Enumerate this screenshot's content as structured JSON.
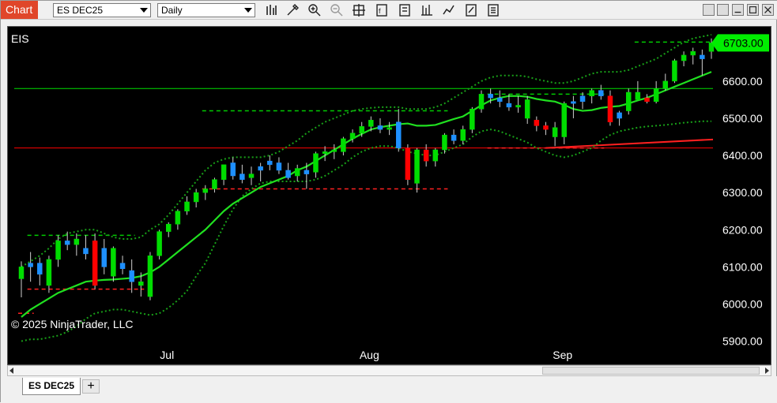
{
  "window": {
    "tab_label": "Chart"
  },
  "toolbar": {
    "instrument": "ES DEC25",
    "interval": "Daily",
    "icons": [
      "bars-type-icon",
      "drawing-tools-icon",
      "zoom-in-icon",
      "zoom-out-icon",
      "crosshair-icon",
      "indicators-icon",
      "strategies-icon",
      "chart-trader-icon",
      "templates-icon",
      "properties-icon",
      "data-box-icon",
      "minimize-icon",
      "maximize-icon",
      "close-icon"
    ]
  },
  "chart": {
    "symbol_label": "EIS",
    "copyright": "© 2025 NinjaTrader, LLC",
    "last_price_label": "6703.00",
    "colors": {
      "up": "#00dd00",
      "down": "#ff0000",
      "flat_up": "#1e90ff",
      "ma": "#20e020",
      "band": "#18a018",
      "background": "#000000",
      "last_price_bg": "#00ee00"
    }
  },
  "chart_data": {
    "type": "candlestick",
    "ylim": [
      5880,
      6725
    ],
    "y_ticks": [
      "6600.00",
      "6500.00",
      "6400.00",
      "6300.00",
      "6200.00",
      "6100.00",
      "6000.00",
      "5900.00"
    ],
    "y_tick_values": [
      6600,
      6500,
      6400,
      6300,
      6200,
      6100,
      6000,
      5900
    ],
    "x_ticks": [
      {
        "label": "Jul",
        "index": 16
      },
      {
        "label": "Aug",
        "index": 38
      },
      {
        "label": "Sep",
        "index": 59
      }
    ],
    "bar_count": 76,
    "candles": [
      {
        "o": 6068,
        "h": 6115,
        "l": 6018,
        "c": 6100,
        "k": "up"
      },
      {
        "o": 6100,
        "h": 6140,
        "l": 6060,
        "c": 6110,
        "k": "flat"
      },
      {
        "o": 6110,
        "h": 6125,
        "l": 6050,
        "c": 6080,
        "k": "flat"
      },
      {
        "o": 6050,
        "h": 6130,
        "l": 6030,
        "c": 6120,
        "k": "up"
      },
      {
        "o": 6120,
        "h": 6185,
        "l": 6100,
        "c": 6170,
        "k": "up"
      },
      {
        "o": 6170,
        "h": 6195,
        "l": 6145,
        "c": 6160,
        "k": "flat"
      },
      {
        "o": 6160,
        "h": 6190,
        "l": 6130,
        "c": 6175,
        "k": "up"
      },
      {
        "o": 6150,
        "h": 6185,
        "l": 6120,
        "c": 6135,
        "k": "flat"
      },
      {
        "o": 6170,
        "h": 6190,
        "l": 6040,
        "c": 6050,
        "k": "down"
      },
      {
        "o": 6150,
        "h": 6175,
        "l": 6080,
        "c": 6100,
        "k": "flat"
      },
      {
        "o": 6075,
        "h": 6155,
        "l": 6060,
        "c": 6150,
        "k": "up"
      },
      {
        "o": 6110,
        "h": 6130,
        "l": 6080,
        "c": 6095,
        "k": "flat"
      },
      {
        "o": 6090,
        "h": 6120,
        "l": 6030,
        "c": 6060,
        "k": "flat"
      },
      {
        "o": 6060,
        "h": 6085,
        "l": 6020,
        "c": 6050,
        "k": "up"
      },
      {
        "o": 6020,
        "h": 6140,
        "l": 6010,
        "c": 6130,
        "k": "up"
      },
      {
        "o": 6130,
        "h": 6200,
        "l": 6120,
        "c": 6195,
        "k": "up"
      },
      {
        "o": 6195,
        "h": 6220,
        "l": 6180,
        "c": 6215,
        "k": "up"
      },
      {
        "o": 6215,
        "h": 6255,
        "l": 6200,
        "c": 6250,
        "k": "up"
      },
      {
        "o": 6250,
        "h": 6290,
        "l": 6240,
        "c": 6275,
        "k": "up"
      },
      {
        "o": 6275,
        "h": 6310,
        "l": 6260,
        "c": 6300,
        "k": "up"
      },
      {
        "o": 6300,
        "h": 6320,
        "l": 6280,
        "c": 6310,
        "k": "up"
      },
      {
        "o": 6310,
        "h": 6340,
        "l": 6300,
        "c": 6335,
        "k": "up"
      },
      {
        "o": 6335,
        "h": 6375,
        "l": 6320,
        "c": 6375,
        "k": "up"
      },
      {
        "o": 6380,
        "h": 6395,
        "l": 6335,
        "c": 6345,
        "k": "flat"
      },
      {
        "o": 6350,
        "h": 6375,
        "l": 6325,
        "c": 6335,
        "k": "flat"
      },
      {
        "o": 6340,
        "h": 6370,
        "l": 6320,
        "c": 6350,
        "k": "up"
      },
      {
        "o": 6360,
        "h": 6380,
        "l": 6330,
        "c": 6370,
        "k": "flat"
      },
      {
        "o": 6385,
        "h": 6400,
        "l": 6360,
        "c": 6375,
        "k": "flat"
      },
      {
        "o": 6380,
        "h": 6395,
        "l": 6350,
        "c": 6360,
        "k": "flat"
      },
      {
        "o": 6360,
        "h": 6380,
        "l": 6335,
        "c": 6340,
        "k": "flat"
      },
      {
        "o": 6345,
        "h": 6375,
        "l": 6330,
        "c": 6365,
        "k": "up"
      },
      {
        "o": 6360,
        "h": 6380,
        "l": 6310,
        "c": 6350,
        "k": "flat"
      },
      {
        "o": 6355,
        "h": 6410,
        "l": 6340,
        "c": 6405,
        "k": "up"
      },
      {
        "o": 6405,
        "h": 6425,
        "l": 6385,
        "c": 6410,
        "k": "up"
      },
      {
        "o": 6410,
        "h": 6430,
        "l": 6390,
        "c": 6415,
        "k": "up"
      },
      {
        "o": 6410,
        "h": 6450,
        "l": 6400,
        "c": 6445,
        "k": "up"
      },
      {
        "o": 6445,
        "h": 6470,
        "l": 6435,
        "c": 6460,
        "k": "up"
      },
      {
        "o": 6460,
        "h": 6490,
        "l": 6450,
        "c": 6478,
        "k": "up"
      },
      {
        "o": 6478,
        "h": 6505,
        "l": 6465,
        "c": 6495,
        "k": "up"
      },
      {
        "o": 6480,
        "h": 6500,
        "l": 6460,
        "c": 6470,
        "k": "flat"
      },
      {
        "o": 6470,
        "h": 6490,
        "l": 6455,
        "c": 6475,
        "k": "up"
      },
      {
        "o": 6490,
        "h": 6525,
        "l": 6410,
        "c": 6420,
        "k": "flat"
      },
      {
        "o": 6420,
        "h": 6430,
        "l": 6320,
        "c": 6335,
        "k": "down"
      },
      {
        "o": 6325,
        "h": 6420,
        "l": 6300,
        "c": 6415,
        "k": "up"
      },
      {
        "o": 6415,
        "h": 6430,
        "l": 6370,
        "c": 6385,
        "k": "down"
      },
      {
        "o": 6385,
        "h": 6420,
        "l": 6370,
        "c": 6415,
        "k": "up"
      },
      {
        "o": 6415,
        "h": 6460,
        "l": 6405,
        "c": 6455,
        "k": "up"
      },
      {
        "o": 6455,
        "h": 6470,
        "l": 6430,
        "c": 6440,
        "k": "flat"
      },
      {
        "o": 6440,
        "h": 6480,
        "l": 6430,
        "c": 6470,
        "k": "up"
      },
      {
        "o": 6470,
        "h": 6530,
        "l": 6460,
        "c": 6525,
        "k": "up"
      },
      {
        "o": 6525,
        "h": 6575,
        "l": 6515,
        "c": 6565,
        "k": "up"
      },
      {
        "o": 6565,
        "h": 6580,
        "l": 6540,
        "c": 6555,
        "k": "flat"
      },
      {
        "o": 6555,
        "h": 6575,
        "l": 6530,
        "c": 6545,
        "k": "flat"
      },
      {
        "o": 6540,
        "h": 6565,
        "l": 6520,
        "c": 6530,
        "k": "flat"
      },
      {
        "o": 6530,
        "h": 6560,
        "l": 6515,
        "c": 6535,
        "k": "up"
      },
      {
        "o": 6500,
        "h": 6560,
        "l": 6485,
        "c": 6550,
        "k": "up"
      },
      {
        "o": 6495,
        "h": 6505,
        "l": 6465,
        "c": 6480,
        "k": "down"
      },
      {
        "o": 6480,
        "h": 6490,
        "l": 6455,
        "c": 6470,
        "k": "down"
      },
      {
        "o": 6475,
        "h": 6490,
        "l": 6425,
        "c": 6450,
        "k": "up"
      },
      {
        "o": 6450,
        "h": 6545,
        "l": 6430,
        "c": 6540,
        "k": "up"
      },
      {
        "o": 6540,
        "h": 6560,
        "l": 6500,
        "c": 6545,
        "k": "flat"
      },
      {
        "o": 6545,
        "h": 6570,
        "l": 6525,
        "c": 6560,
        "k": "flat"
      },
      {
        "o": 6560,
        "h": 6580,
        "l": 6540,
        "c": 6575,
        "k": "up"
      },
      {
        "o": 6575,
        "h": 6590,
        "l": 6550,
        "c": 6560,
        "k": "flat"
      },
      {
        "o": 6560,
        "h": 6575,
        "l": 6480,
        "c": 6490,
        "k": "down"
      },
      {
        "o": 6500,
        "h": 6520,
        "l": 6480,
        "c": 6515,
        "k": "flat"
      },
      {
        "o": 6520,
        "h": 6580,
        "l": 6510,
        "c": 6570,
        "k": "up"
      },
      {
        "o": 6570,
        "h": 6600,
        "l": 6550,
        "c": 6550,
        "k": "up"
      },
      {
        "o": 6555,
        "h": 6565,
        "l": 6540,
        "c": 6545,
        "k": "down"
      },
      {
        "o": 6545,
        "h": 6600,
        "l": 6540,
        "c": 6580,
        "k": "up"
      },
      {
        "o": 6580,
        "h": 6620,
        "l": 6575,
        "c": 6600,
        "k": "up"
      },
      {
        "o": 6600,
        "h": 6660,
        "l": 6595,
        "c": 6655,
        "k": "up"
      },
      {
        "o": 6655,
        "h": 6680,
        "l": 6640,
        "c": 6670,
        "k": "up"
      },
      {
        "o": 6670,
        "h": 6690,
        "l": 6645,
        "c": 6680,
        "k": "up"
      },
      {
        "o": 6670,
        "h": 6685,
        "l": 6615,
        "c": 6660,
        "k": "flat"
      },
      {
        "o": 6680,
        "h": 6715,
        "l": 6660,
        "c": 6703,
        "k": "up"
      }
    ],
    "moving_average": [
      5965,
      5985,
      6000,
      6015,
      6030,
      6040,
      6050,
      6060,
      6063,
      6065,
      6066,
      6068,
      6070,
      6075,
      6085,
      6100,
      6120,
      6140,
      6160,
      6180,
      6200,
      6225,
      6250,
      6270,
      6285,
      6300,
      6315,
      6325,
      6335,
      6345,
      6360,
      6370,
      6385,
      6400,
      6415,
      6430,
      6445,
      6458,
      6470,
      6476,
      6480,
      6484,
      6486,
      6480,
      6480,
      6482,
      6490,
      6498,
      6505,
      6520,
      6535,
      6548,
      6555,
      6560,
      6560,
      6558,
      6552,
      6548,
      6545,
      6536,
      6525,
      6520,
      6522,
      6528,
      6531,
      6533,
      6540,
      6548,
      6555,
      6565,
      6575,
      6585,
      6595,
      6605,
      6615,
      6625
    ],
    "band_upper": [
      6100,
      6115,
      6130,
      6150,
      6175,
      6190,
      6195,
      6200,
      6200,
      6190,
      6180,
      6175,
      6175,
      6180,
      6200,
      6215,
      6240,
      6270,
      6300,
      6330,
      6360,
      6380,
      6390,
      6395,
      6395,
      6395,
      6395,
      6400,
      6410,
      6425,
      6440,
      6460,
      6475,
      6490,
      6500,
      6510,
      6520,
      6525,
      6528,
      6530,
      6530,
      6530,
      6525,
      6525,
      6525,
      6530,
      6540,
      6555,
      6570,
      6585,
      6600,
      6610,
      6615,
      6615,
      6615,
      6612,
      6605,
      6600,
      6595,
      6595,
      6600,
      6610,
      6620,
      6625,
      6625,
      6625,
      6630,
      6640,
      6650,
      6660,
      6675,
      6690,
      6705,
      6715,
      6720,
      6725
    ],
    "band_lower": [
      5900,
      5905,
      5905,
      5910,
      5915,
      5925,
      5940,
      5960,
      5975,
      5980,
      5985,
      5985,
      5980,
      5975,
      5970,
      5975,
      5990,
      6010,
      6035,
      6075,
      6110,
      6160,
      6210,
      6255,
      6290,
      6310,
      6325,
      6330,
      6330,
      6330,
      6330,
      6330,
      6335,
      6345,
      6360,
      6375,
      6395,
      6410,
      6420,
      6425,
      6425,
      6420,
      6410,
      6405,
      6400,
      6400,
      6410,
      6420,
      6430,
      6450,
      6465,
      6470,
      6465,
      6455,
      6445,
      6435,
      6420,
      6410,
      6400,
      6395,
      6400,
      6410,
      6420,
      6440,
      6455,
      6465,
      6470,
      6475,
      6478,
      6480,
      6482,
      6485,
      6488,
      6490,
      6492,
      6492
    ],
    "level_lines": [
      {
        "value": 6580,
        "color": "#00dd00",
        "style": "solid",
        "from_index": 0,
        "to_index": 75
      },
      {
        "value": 6420,
        "color": "#ff0000",
        "style": "solid",
        "from_index": 0,
        "to_index": 75
      },
      {
        "value": 6520,
        "color": "#00cc00",
        "style": "dashed",
        "from_index": 20,
        "to_index": 46
      },
      {
        "value": 6310,
        "color": "#ff2020",
        "style": "dashed",
        "from_index": 20,
        "to_index": 46
      },
      {
        "value": 6185,
        "color": "#00cc00",
        "style": "dashed",
        "from_index": 1,
        "to_index": 12
      },
      {
        "value": 6040,
        "color": "#ff2020",
        "style": "dashed",
        "from_index": 1,
        "to_index": 13
      },
      {
        "value": 5975,
        "color": "#ff2020",
        "style": "dashed",
        "from_index": 0,
        "to_index": 1
      },
      {
        "value": 6565,
        "color": "#00cc00",
        "style": "dashed",
        "from_index": 51,
        "to_index": 63
      },
      {
        "value": 6420,
        "color": "#ff2020",
        "style": "dashed",
        "from_index": 51,
        "to_index": 63
      },
      {
        "value": 6705,
        "color": "#00cc00",
        "style": "dashed",
        "from_index": 67,
        "to_index": 75
      }
    ],
    "trend_line": {
      "from_index": 57,
      "from_value": 6420,
      "to_index": 78,
      "to_value": 6443,
      "color": "#ff2020"
    }
  }
}
